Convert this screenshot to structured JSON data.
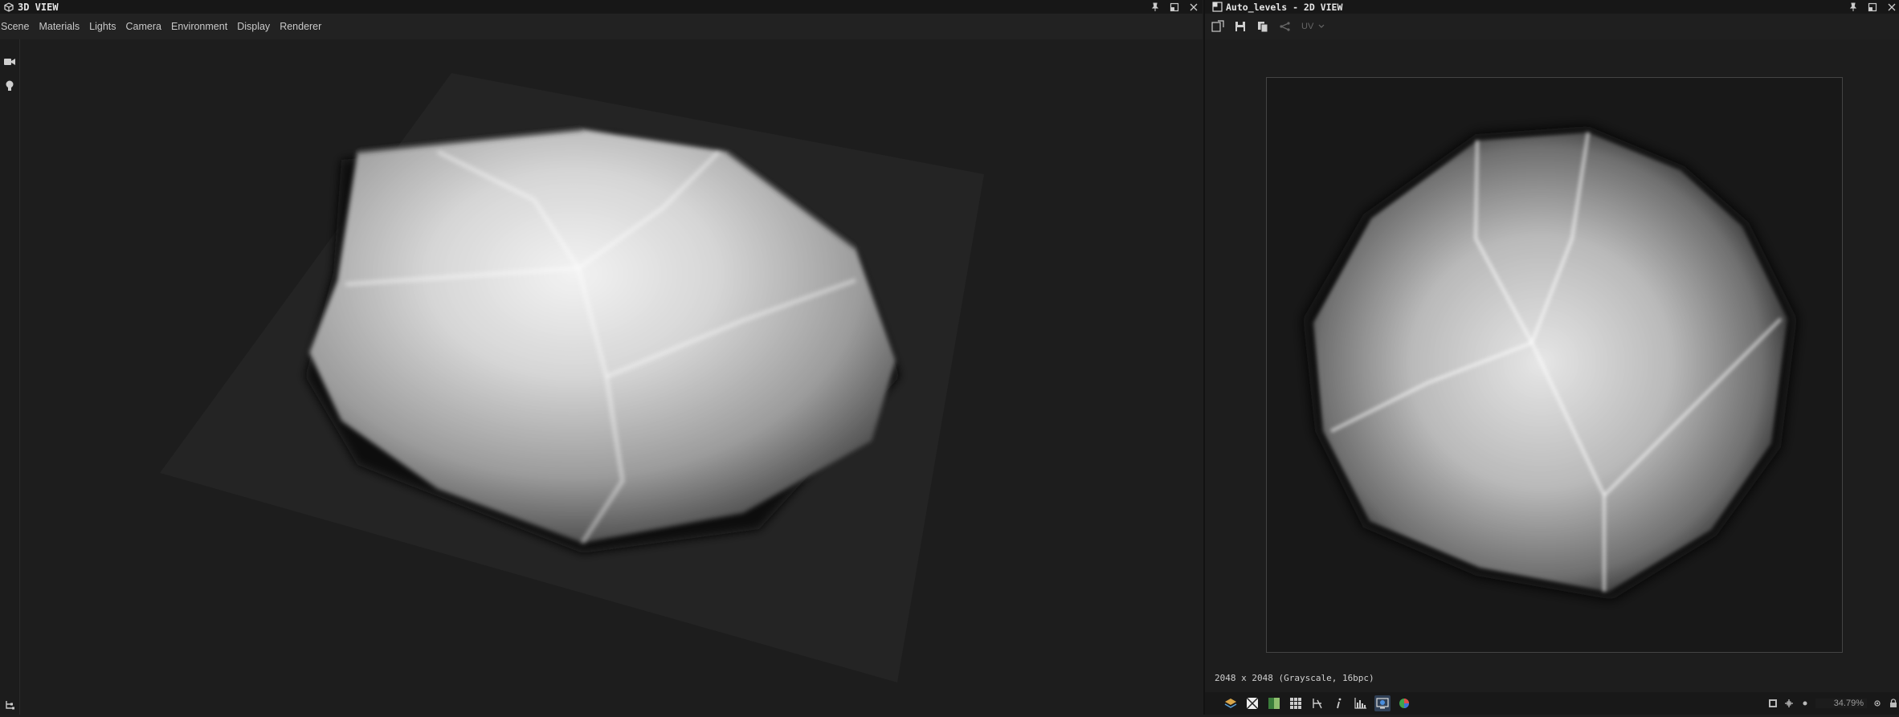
{
  "panel3d": {
    "title": "3D VIEW",
    "menu": [
      "Scene",
      "Materials",
      "Lights",
      "Camera",
      "Environment",
      "Display",
      "Renderer"
    ],
    "left_tools": [
      "camera-icon",
      "light-bulb-icon"
    ],
    "bottom_tool": "hierarchy-icon"
  },
  "panel2d": {
    "title": "Auto_levels - 2D VIEW",
    "toolbar": [
      "new-document-icon",
      "save-icon",
      "copy-icon",
      "share-icon"
    ],
    "uv_label": "UV",
    "info": "2048 x 2048 (Grayscale, 16bpc)",
    "zoom": "34.79%",
    "status_icons": [
      "layers-icon",
      "checker-icon",
      "gradient-icon",
      "grid-icon",
      "tiling-icon",
      "info-icon",
      "histogram-icon",
      "view-mode-icon",
      "color-ball-icon"
    ],
    "status_right_icons": [
      "fit-icon",
      "pan-icon",
      "zoom-out-icon",
      "zoom-in-icon",
      "lock-icon"
    ]
  },
  "colors": {
    "background": "#1e1e1e",
    "titlebar": "#171717",
    "accent": "#2f3f55"
  }
}
